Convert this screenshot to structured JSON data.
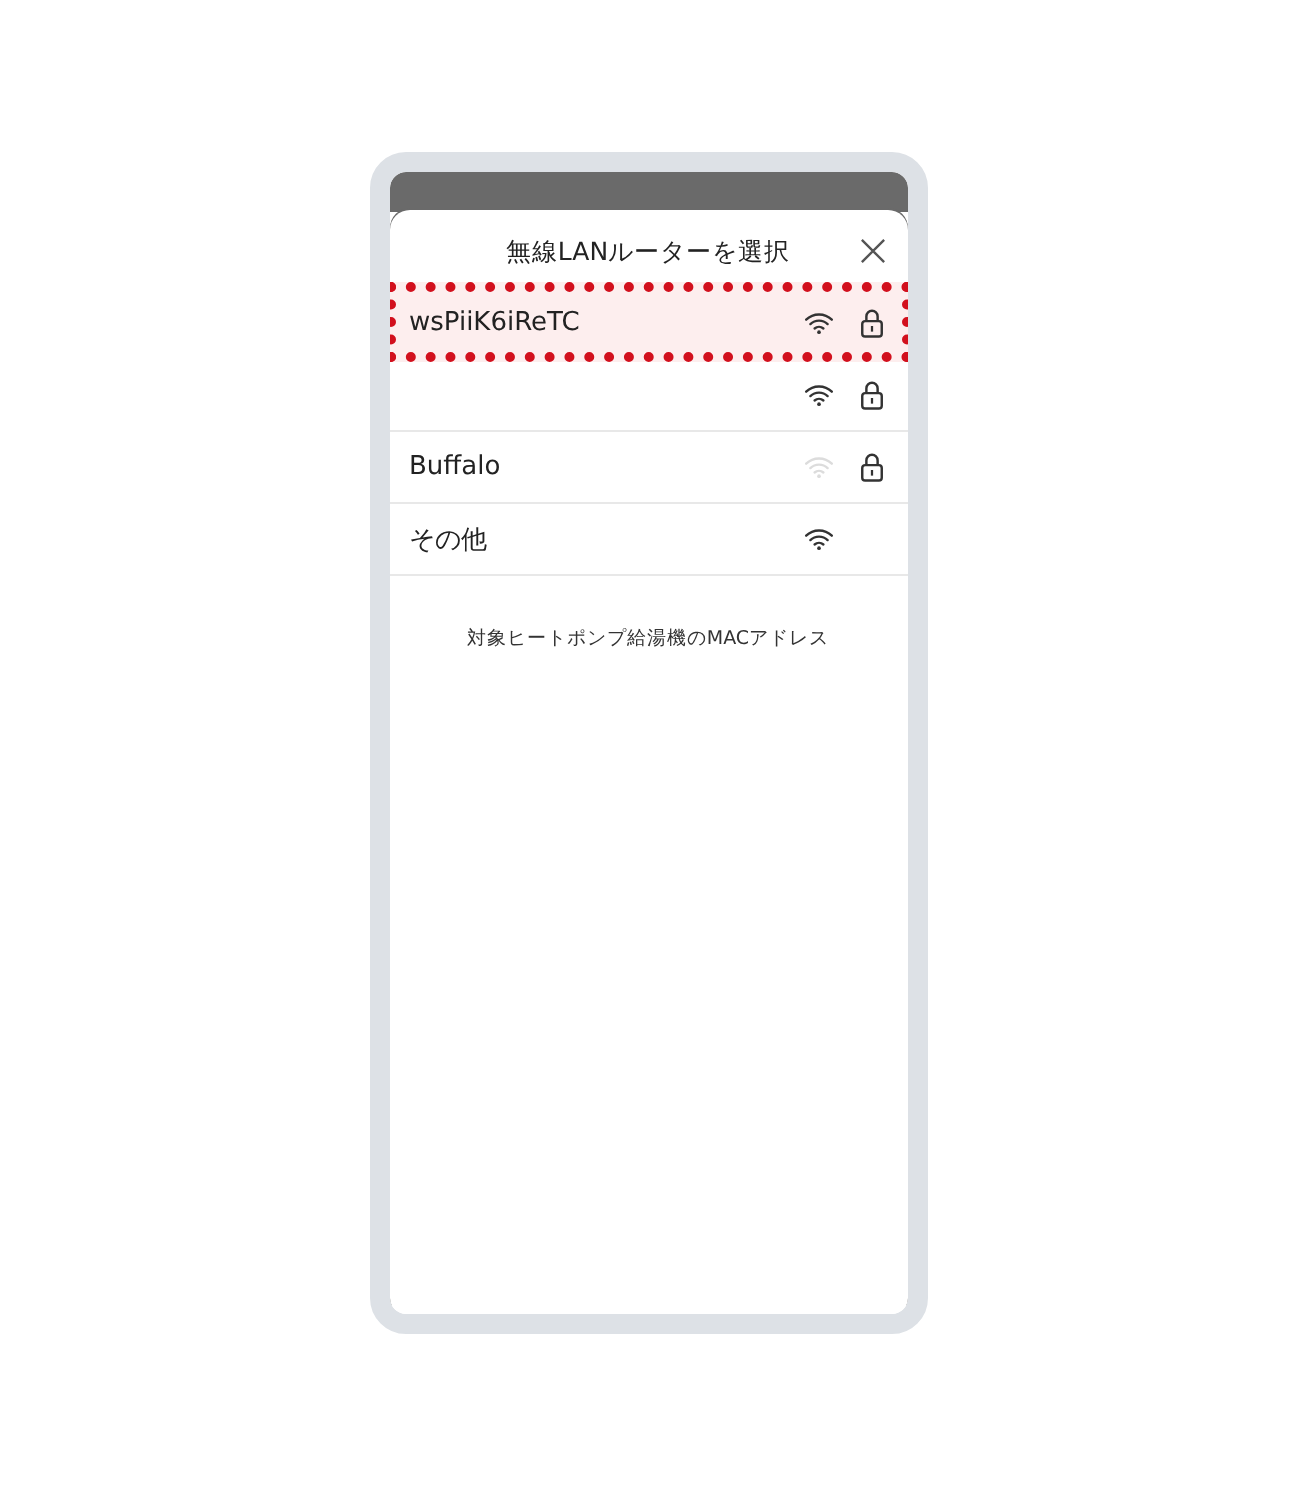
{
  "header": {
    "title": "無線LANルーターを選択"
  },
  "networks": [
    {
      "name": "wsPiiK6iReTC",
      "selected": true,
      "signal_faint": false,
      "locked": true
    },
    {
      "selected": false,
      "signal_faint": false,
      "locked": true
    },
    {
      "name": "Buffalo",
      "selected": false,
      "signal_faint": true,
      "locked": true
    },
    {
      "name": "その他",
      "selected": false,
      "signal_faint": false,
      "locked": false
    }
  ],
  "footer_note": "対象ヒートポンプ給湯機のMACアドレス"
}
